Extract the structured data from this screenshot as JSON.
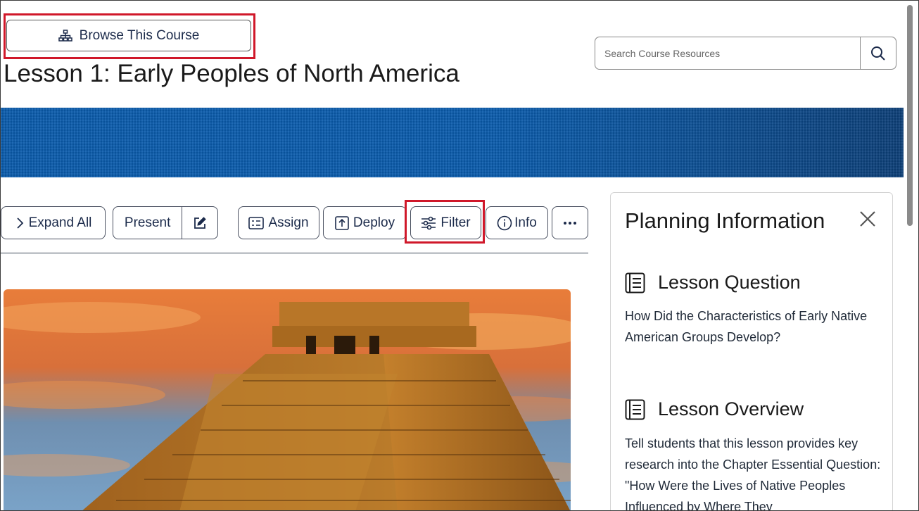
{
  "header": {
    "browse_label": "Browse This Course",
    "page_title": "Lesson 1: Early Peoples of North America",
    "search": {
      "placeholder": "Search Course Resources",
      "value": ""
    }
  },
  "toolbar": {
    "expand_all": "Expand All",
    "present": "Present",
    "assign": "Assign",
    "deploy": "Deploy",
    "filter": "Filter",
    "info": "Info"
  },
  "panel": {
    "title": "Planning Information",
    "sections": [
      {
        "title": "Lesson Question",
        "body": "How Did the Characteristics of Early Native American Groups Develop?"
      },
      {
        "title": "Lesson Overview",
        "body": "Tell students that this lesson provides key research into the Chapter Essential Question: \"How Were the Lives of Native Peoples Influenced by Where They"
      }
    ]
  },
  "colors": {
    "banner_blue": "#0a5cad",
    "highlight_red": "#d0182a",
    "text_navy": "#1b2a4a"
  },
  "icons": [
    "sitemap-icon",
    "search-icon",
    "chevron-right-icon",
    "edit-icon",
    "assignment-icon",
    "upload-icon",
    "sliders-icon",
    "info-icon",
    "more-icon",
    "close-icon",
    "list-document-icon"
  ]
}
